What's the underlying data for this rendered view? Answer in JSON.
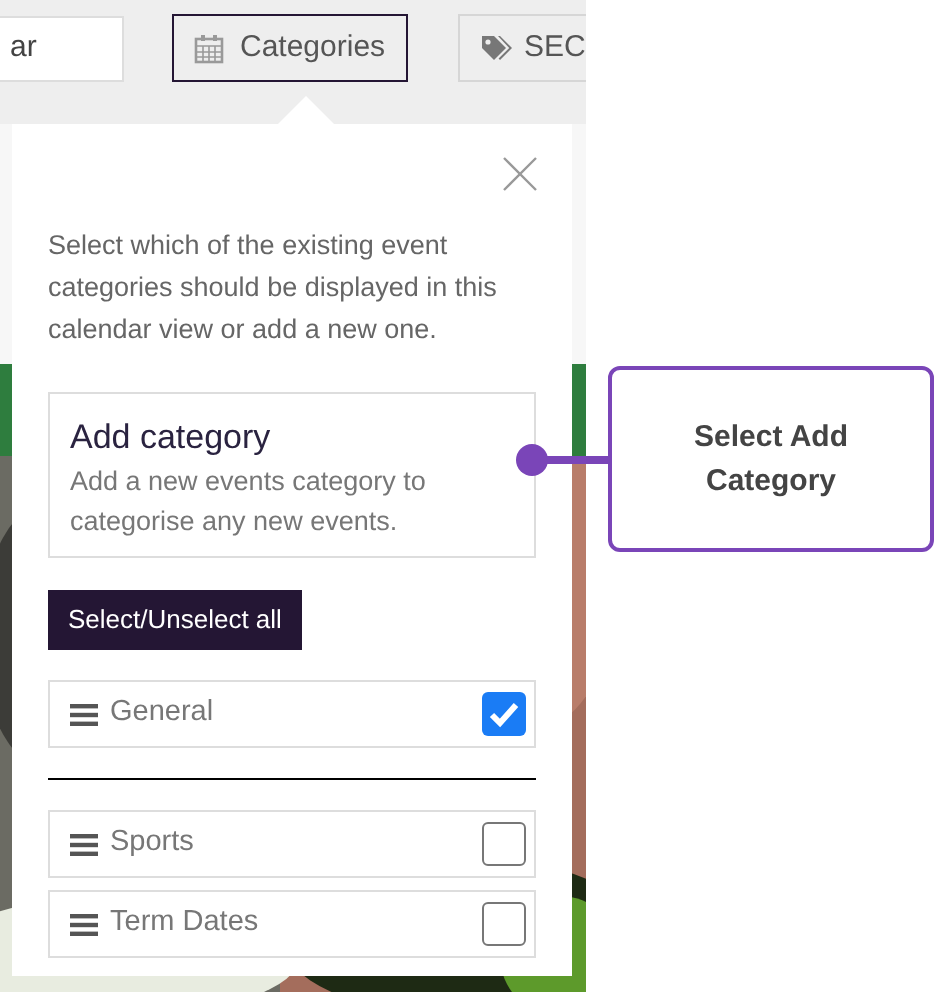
{
  "toolbar": {
    "search_field": {
      "value": "ar"
    },
    "buttons": [
      {
        "label": "Categories",
        "selected": true
      },
      {
        "label": "SEC",
        "selected": false
      }
    ]
  },
  "popover": {
    "description": "Select which of the existing event categories should be displayed in this calendar view or add a new one.",
    "add_category": {
      "title": "Add category",
      "description": "Add a new events category to categorise any new events."
    },
    "select_all_button": "Select/Unselect all",
    "groups": [
      {
        "items": [
          {
            "label": "General",
            "checked": true
          }
        ]
      },
      {
        "items": [
          {
            "label": "Sports",
            "checked": false
          },
          {
            "label": "Term Dates",
            "checked": false
          }
        ]
      }
    ]
  },
  "callout": {
    "text": "Select Add Category"
  }
}
